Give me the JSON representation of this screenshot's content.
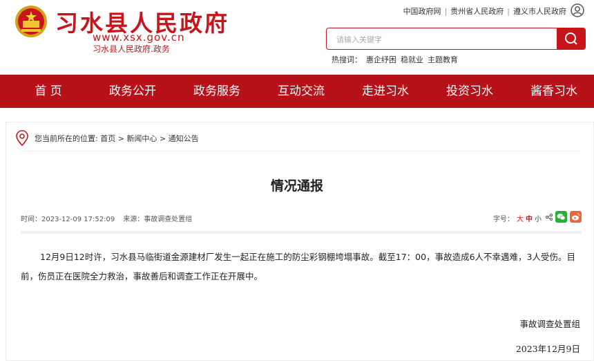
{
  "header": {
    "site_title": "习水县人民政府",
    "site_url": "www.xsx.gov.cn",
    "site_sub": "习水县人民政府.政务",
    "top_links": [
      "中国政府网",
      "贵州省人民政府",
      "遵义市人民政府"
    ]
  },
  "search": {
    "placeholder": "请输入关键字",
    "hot_label": "热搜词：",
    "hot_words": [
      "惠企纾困",
      "稳就业",
      "主题教育"
    ]
  },
  "nav": {
    "items": [
      "首 页",
      "政务公开",
      "政务服务",
      "互动交流",
      "走进习水",
      "投资习水",
      "酱香习水"
    ]
  },
  "breadcrumb": {
    "prefix": "您当前所在的位置:",
    "items": [
      "首页",
      "新闻中心",
      "通知公告"
    ],
    "separator": ">"
  },
  "article": {
    "title": "情况通报",
    "time": "时间：2023-12-09 17:52:09",
    "source": "来源：事故调查处置组",
    "font_size_label": "字号：",
    "font_big": "大",
    "font_mid": "中",
    "font_small": "小",
    "body": "12月9日12时许，习水县马临街道金源建材厂发生一起正在施工的防尘彩钢棚垮塌事故。截至17：00，事故造成6人不幸遇难，3人受伤。目前，伤员正在医院全力救治，事故善后和调查工作正在开展中。",
    "signature": "事故调查处置组",
    "date": "2023年12月9日"
  },
  "colors": {
    "brand_red": "#c8151b",
    "nav_red": "#b7121a"
  },
  "icons": [
    "national-emblem-icon",
    "user-icon",
    "search-icon",
    "location-pin-icon",
    "share-icon",
    "wechat-icon",
    "weibo-icon"
  ]
}
